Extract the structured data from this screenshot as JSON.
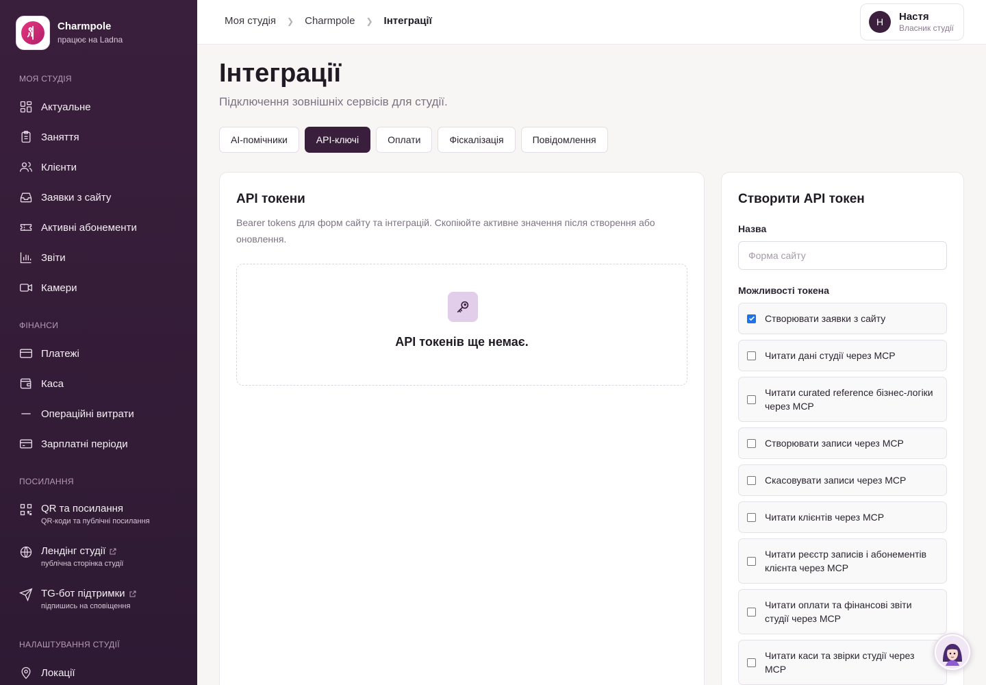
{
  "brand": {
    "name": "Charmpole",
    "subtitle": "працює на Ladna"
  },
  "sidebar": {
    "sections": [
      {
        "title": "Моя студія",
        "items": [
          {
            "label": "Актуальне",
            "icon": "grid-icon"
          },
          {
            "label": "Заняття",
            "icon": "clipboard-icon"
          },
          {
            "label": "Клієнти",
            "icon": "users-icon"
          },
          {
            "label": "Заявки з сайту",
            "icon": "inbox-icon"
          },
          {
            "label": "Активні абонементи",
            "icon": "ticket-icon"
          },
          {
            "label": "Звіти",
            "icon": "bar-chart-icon"
          },
          {
            "label": "Камери",
            "icon": "video-icon"
          }
        ]
      },
      {
        "title": "Фінанси",
        "items": [
          {
            "label": "Платежі",
            "icon": "credit-card-icon"
          },
          {
            "label": "Каса",
            "icon": "wallet-icon"
          },
          {
            "label": "Операційні витрати",
            "icon": "minus-icon"
          },
          {
            "label": "Зарплатні періоди",
            "icon": "payroll-icon"
          }
        ]
      },
      {
        "title": "Посилання",
        "items": [
          {
            "label": "QR та посилання",
            "sub": "QR-коди та публічні посилання",
            "icon": "qr-code-icon"
          },
          {
            "label": "Лендінг студії",
            "sub": "публічна сторінка студії",
            "icon": "globe-icon",
            "external": true
          },
          {
            "label": "TG-бот підтримки",
            "sub": "підпишись на сповіщення",
            "icon": "send-icon",
            "external": true
          }
        ]
      },
      {
        "title": "Налаштування студії",
        "items": [
          {
            "label": "Локації",
            "icon": "map-pin-icon"
          }
        ]
      }
    ]
  },
  "breadcrumbs": [
    "Моя студія",
    "Charmpole",
    "Інтеграції"
  ],
  "user": {
    "initial": "Н",
    "name": "Настя",
    "role": "Власник студії"
  },
  "page": {
    "title": "Інтеграції",
    "subtitle": "Підключення зовнішніх сервісів для студії."
  },
  "tabs": [
    {
      "label": "AI-помічники",
      "active": false
    },
    {
      "label": "API-ключі",
      "active": true
    },
    {
      "label": "Оплати",
      "active": false
    },
    {
      "label": "Фіскалізація",
      "active": false
    },
    {
      "label": "Повідомлення",
      "active": false
    }
  ],
  "tokens_card": {
    "title": "API токени",
    "description": "Bearer tokens для форм сайту та інтеграцій. Скопіюйте активне значення після створення або оновлення.",
    "empty_text": "API токенів ще немає."
  },
  "create_card": {
    "title": "Створити API токен",
    "name_label": "Назва",
    "name_placeholder": "Форма сайту",
    "name_value": "",
    "capabilities_label": "Можливості токена",
    "capabilities": [
      {
        "label": "Створювати заявки з сайту",
        "checked": true
      },
      {
        "label": "Читати дані студії через MCP",
        "checked": false
      },
      {
        "label": "Читати curated reference бізнес-логіки через MCP",
        "checked": false
      },
      {
        "label": "Створювати записи через MCP",
        "checked": false
      },
      {
        "label": "Скасовувати записи через MCP",
        "checked": false
      },
      {
        "label": "Читати клієнтів через MCP",
        "checked": false
      },
      {
        "label": "Читати реєстр записів і абонементів клієнта через MCP",
        "checked": false
      },
      {
        "label": "Читати оплати та фінансові звіти студії через MCP",
        "checked": false
      },
      {
        "label": "Читати каси та звірки студії через MCP",
        "checked": false
      }
    ]
  },
  "colors": {
    "sidebar_bg": "#3a1f3c",
    "accent": "#3a1f3c",
    "checkbox": "#1d73e8",
    "icon_tile": "#e2cdea"
  }
}
